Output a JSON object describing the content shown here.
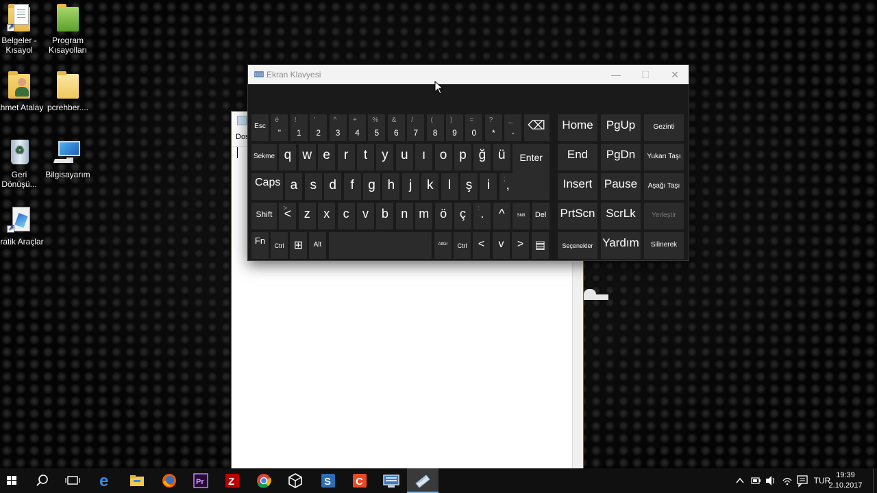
{
  "desktop": {
    "icons": [
      {
        "label": "Belgeler - Kısayol",
        "icon": "documents-shortcut-icon"
      },
      {
        "label": "Program Kısayolları",
        "icon": "green-folder-icon"
      },
      {
        "label": "Ahmet Atalay",
        "icon": "user-folder-icon"
      },
      {
        "label": "pcrehber....",
        "icon": "folder-icon"
      },
      {
        "label": "Geri Dönüşü...",
        "icon": "recycle-bin-icon"
      },
      {
        "label": "Bilgisayarım",
        "icon": "computer-icon"
      },
      {
        "label": "Pratik Araçlar",
        "icon": "tools-shortcut-icon"
      }
    ]
  },
  "background_window": {
    "menu_partial": "Dos"
  },
  "osk": {
    "title": "Ekran Klavyesi",
    "window_buttons": {
      "minimize": "—",
      "maximize": "☐",
      "close": "✕"
    },
    "row1": [
      {
        "main": "Esc",
        "shift": ""
      },
      {
        "main": "\"",
        "shift": "é"
      },
      {
        "main": "1",
        "shift": "!"
      },
      {
        "main": "2",
        "shift": "'"
      },
      {
        "main": "3",
        "shift": "^"
      },
      {
        "main": "4",
        "shift": "+"
      },
      {
        "main": "5",
        "shift": "%"
      },
      {
        "main": "6",
        "shift": "&"
      },
      {
        "main": "7",
        "shift": "/"
      },
      {
        "main": "8",
        "shift": "("
      },
      {
        "main": "9",
        "shift": ")"
      },
      {
        "main": "0",
        "shift": "="
      },
      {
        "main": "*",
        "shift": "?"
      },
      {
        "main": "-",
        "shift": "_"
      },
      {
        "main": "⌫",
        "shift": ""
      }
    ],
    "row2": [
      {
        "main": "Sekme",
        "shift": ""
      },
      {
        "main": "q",
        "shift": ""
      },
      {
        "main": "w",
        "shift": ""
      },
      {
        "main": "e",
        "shift": ""
      },
      {
        "main": "r",
        "shift": ""
      },
      {
        "main": "t",
        "shift": ""
      },
      {
        "main": "y",
        "shift": ""
      },
      {
        "main": "u",
        "shift": ""
      },
      {
        "main": "ı",
        "shift": ""
      },
      {
        "main": "o",
        "shift": ""
      },
      {
        "main": "p",
        "shift": ""
      },
      {
        "main": "ğ",
        "shift": ""
      },
      {
        "main": "ü",
        "shift": ""
      },
      {
        "main": "Enter",
        "shift": ""
      }
    ],
    "row3": [
      {
        "main": "Caps",
        "shift": ""
      },
      {
        "main": "a",
        "shift": ""
      },
      {
        "main": "s",
        "shift": ""
      },
      {
        "main": "d",
        "shift": ""
      },
      {
        "main": "f",
        "shift": ""
      },
      {
        "main": "g",
        "shift": ""
      },
      {
        "main": "h",
        "shift": ""
      },
      {
        "main": "j",
        "shift": ""
      },
      {
        "main": "k",
        "shift": ""
      },
      {
        "main": "l",
        "shift": ""
      },
      {
        "main": "ş",
        "shift": ""
      },
      {
        "main": "i",
        "shift": ""
      },
      {
        "main": ",",
        "shift": ";"
      }
    ],
    "row4": [
      {
        "main": "Shift",
        "shift": ""
      },
      {
        "main": "<",
        "shift": ">"
      },
      {
        "main": "z",
        "shift": ""
      },
      {
        "main": "x",
        "shift": ""
      },
      {
        "main": "c",
        "shift": ""
      },
      {
        "main": "v",
        "shift": ""
      },
      {
        "main": "b",
        "shift": ""
      },
      {
        "main": "n",
        "shift": ""
      },
      {
        "main": "m",
        "shift": ""
      },
      {
        "main": "ö",
        "shift": ""
      },
      {
        "main": "ç",
        "shift": ""
      },
      {
        "main": ".",
        "shift": ":"
      },
      {
        "main": "^",
        "shift": ""
      },
      {
        "main": "Shift",
        "shift": ""
      },
      {
        "main": "Del",
        "shift": ""
      }
    ],
    "row5": [
      {
        "main": "Fn",
        "shift": ""
      },
      {
        "main": "Ctrl",
        "shift": ""
      },
      {
        "main": "⊞",
        "shift": ""
      },
      {
        "main": "Alt",
        "shift": ""
      },
      {
        "main": "",
        "shift": ""
      },
      {
        "main": "AltGr",
        "shift": ""
      },
      {
        "main": "Ctrl",
        "shift": ""
      },
      {
        "main": "<",
        "shift": ""
      },
      {
        "main": "v",
        "shift": ""
      },
      {
        "main": ">",
        "shift": ""
      },
      {
        "main": "▤",
        "shift": ""
      }
    ],
    "nav": [
      [
        "Home",
        "PgUp",
        "Gezinti"
      ],
      [
        "End",
        "PgDn",
        "Yukarı Taşı"
      ],
      [
        "Insert",
        "Pause",
        "Aşağı Taşı"
      ],
      [
        "PrtScn",
        "ScrLk",
        "Yerleştir"
      ],
      [
        "Seçenekler",
        "Yardım",
        "Silinerek"
      ]
    ]
  },
  "taskbar": {
    "apps": [
      "start-icon",
      "search-icon",
      "task-view-icon",
      "edge-icon",
      "file-explorer-icon",
      "firefox-icon",
      "premiere-icon",
      "filezilla-icon",
      "chrome-icon",
      "virtualbox-icon",
      "snagit-icon",
      "camtasia-icon",
      "remote-desktop-icon",
      "on-screen-keyboard-icon"
    ],
    "language": "TUR",
    "time": "19:39",
    "date": "2.10.2017"
  },
  "colors": {
    "osk_bg": "#1a1a1a",
    "key_bg": "#2b2b2b",
    "taskbar_bg": "#101010",
    "accent": "#76b9ed"
  }
}
